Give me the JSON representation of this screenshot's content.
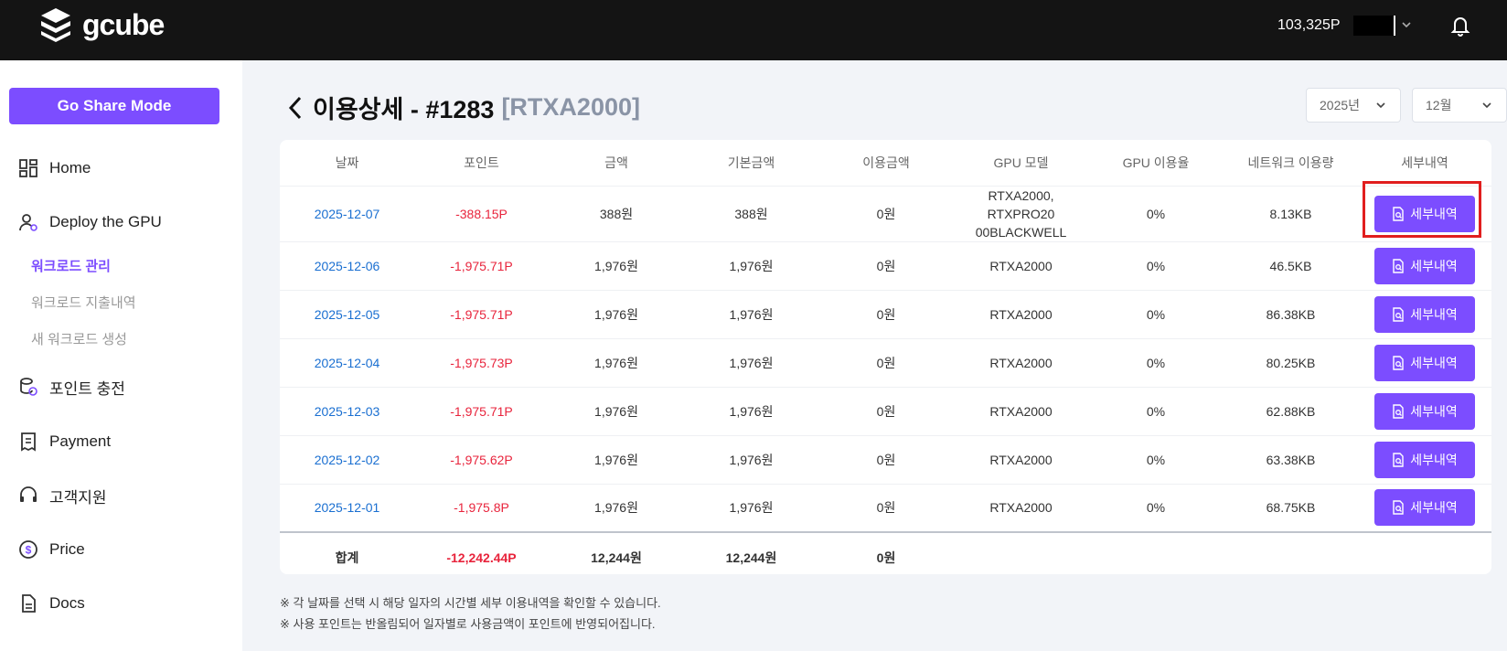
{
  "header": {
    "logo_text": "gcube",
    "points": "103,325P"
  },
  "sidebar": {
    "share_button": "Go Share Mode",
    "items": [
      {
        "label": "Home",
        "icon": "dashboard-icon"
      },
      {
        "label": "Deploy the GPU",
        "icon": "user-gear-icon"
      },
      {
        "label": "포인트 충전",
        "icon": "coins-icon"
      },
      {
        "label": "Payment",
        "icon": "receipt-icon"
      },
      {
        "label": "고객지원",
        "icon": "headset-icon"
      },
      {
        "label": "Price",
        "icon": "dollar-icon"
      },
      {
        "label": "Docs",
        "icon": "document-icon"
      }
    ],
    "sub_items": [
      "워크로드 관리",
      "워크로드 지출내역",
      "새 워크로드 생성"
    ]
  },
  "main": {
    "title": "이용상세 - #1283",
    "title_model": "[RTXA2000]",
    "year_select": "2025년",
    "month_select": "12월",
    "columns": [
      "날짜",
      "포인트",
      "금액",
      "기본금액",
      "이용금액",
      "GPU 모델",
      "GPU 이용율",
      "네트워크 이용량",
      "세부내역"
    ],
    "detail_label": "세부내역",
    "rows": [
      {
        "date": "2025-12-07",
        "points": "-388.15P",
        "amount": "388원",
        "base": "388원",
        "usage": "0원",
        "gpu_line1": "RTXA2000, RTXPRO20",
        "gpu_line2": "00BLACKWELL",
        "util": "0%",
        "network": "8.13KB"
      },
      {
        "date": "2025-12-06",
        "points": "-1,975.71P",
        "amount": "1,976원",
        "base": "1,976원",
        "usage": "0원",
        "gpu_line1": "RTXA2000",
        "gpu_line2": "",
        "util": "0%",
        "network": "46.5KB"
      },
      {
        "date": "2025-12-05",
        "points": "-1,975.71P",
        "amount": "1,976원",
        "base": "1,976원",
        "usage": "0원",
        "gpu_line1": "RTXA2000",
        "gpu_line2": "",
        "util": "0%",
        "network": "86.38KB"
      },
      {
        "date": "2025-12-04",
        "points": "-1,975.73P",
        "amount": "1,976원",
        "base": "1,976원",
        "usage": "0원",
        "gpu_line1": "RTXA2000",
        "gpu_line2": "",
        "util": "0%",
        "network": "80.25KB"
      },
      {
        "date": "2025-12-03",
        "points": "-1,975.71P",
        "amount": "1,976원",
        "base": "1,976원",
        "usage": "0원",
        "gpu_line1": "RTXA2000",
        "gpu_line2": "",
        "util": "0%",
        "network": "62.88KB"
      },
      {
        "date": "2025-12-02",
        "points": "-1,975.62P",
        "amount": "1,976원",
        "base": "1,976원",
        "usage": "0원",
        "gpu_line1": "RTXA2000",
        "gpu_line2": "",
        "util": "0%",
        "network": "63.38KB"
      },
      {
        "date": "2025-12-01",
        "points": "-1,975.8P",
        "amount": "1,976원",
        "base": "1,976원",
        "usage": "0원",
        "gpu_line1": "RTXA2000",
        "gpu_line2": "",
        "util": "0%",
        "network": "68.75KB"
      }
    ],
    "total": {
      "label": "합계",
      "points": "-12,242.44P",
      "amount": "12,244원",
      "base": "12,244원",
      "usage": "0원"
    },
    "notes": [
      "※ 각 날짜를 선택 시 해당 일자의 시간별 세부 이용내역을 확인할 수 있습니다.",
      "※ 사용 포인트는 반올림되어 일자별로 사용금액이 포인트에 반영되어집니다."
    ]
  },
  "colors": {
    "accent": "#7c4dff",
    "negative": "#e8243c",
    "date_link": "#1a6fd1",
    "highlight": "#e11e1e"
  }
}
